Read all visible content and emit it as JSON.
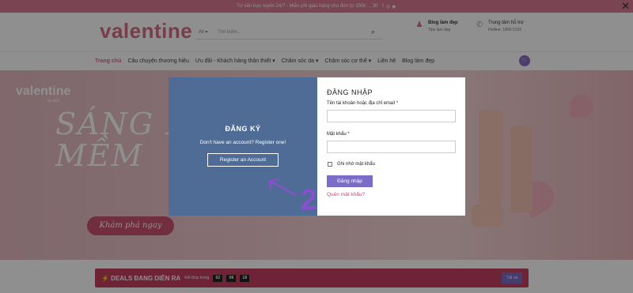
{
  "topbar": {
    "text": "Tư vấn trực tuyến 24/7 - Miễn phí giao hàng cho đơn từ 150k ... 30",
    "social_icons": [
      "facebook-icon",
      "instagram-icon",
      "youtube-icon"
    ]
  },
  "header": {
    "logo": "valentine",
    "search": {
      "category": "All ▾",
      "placeholder": "Tìm kiếm..."
    },
    "blog": {
      "title": "Blog làm đẹp",
      "subtitle": "Tips làm đẹp"
    },
    "support": {
      "title": "Trung tâm hỗ trợ",
      "subtitle": "Hotline: 1800 5199"
    }
  },
  "nav": {
    "items": [
      "Trang chủ",
      "Câu chuyện thương hiệu",
      "Ưu đãi - Khách hàng thân thiết ▾",
      "Chăm sóc da ▾",
      "Chăm sóc cơ thể ▾",
      "Liên hệ",
      "Blog làm đẹp"
    ]
  },
  "banner": {
    "logo": "valentine",
    "logo_tag": "by Acti",
    "headline_1": "SÁNG H",
    "headline_2": "MỀM",
    "cta": "Khám phá ngay"
  },
  "deals": {
    "title": "⚡ DEALS ĐANG DIỄN RA",
    "sub": "Kết thúc trong",
    "timer": [
      "02",
      "08",
      "18"
    ],
    "view_all": "Tất cả"
  },
  "modal": {
    "register": {
      "title": "ĐĂNG KÝ",
      "subtitle": "Don't have an account? Register one!",
      "button": "Register an Account"
    },
    "login": {
      "title": "ĐĂNG NHẬP",
      "username_label": "Tên tài khoản hoặc địa chỉ email *",
      "password_label": "Mật khẩu *",
      "remember_label": "Ghi nhớ mật khẩu",
      "button": "Đăng nhập",
      "forgot": "Quên mật khẩu?"
    }
  },
  "annotation": {
    "number": "2",
    "color": "#8a4fd1"
  },
  "colors": {
    "brand": "#d86b86",
    "register_bg": "#4e6c95",
    "login_btn": "#7b6cc8",
    "deals_bg": "#c7405f"
  }
}
